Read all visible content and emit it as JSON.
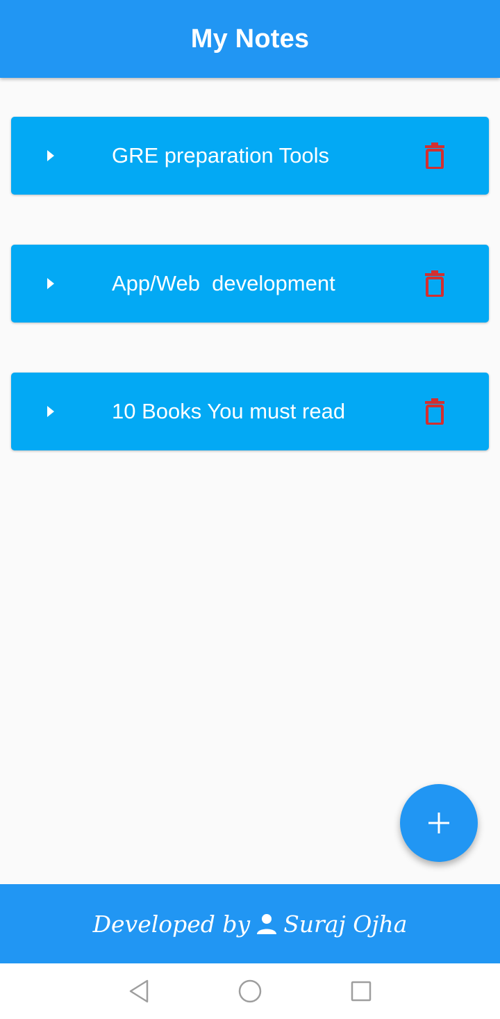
{
  "app": {
    "title": "My Notes"
  },
  "notes": [
    {
      "title": "GRE preparation Tools"
    },
    {
      "title": "App/Web  development"
    },
    {
      "title": "10 Books You must read"
    }
  ],
  "footer": {
    "prefix": "Developed by",
    "author": "Suraj Ojha",
    "icon": "person-icon"
  },
  "icons": {
    "expand": "arrow-right-icon",
    "delete": "trash-icon",
    "fab": "plus-icon",
    "nav": [
      "back-icon",
      "home-icon",
      "recents-icon"
    ]
  },
  "colors": {
    "primary": "#2196F3",
    "card": "#03A9F4",
    "delete": "#D32F2F",
    "background": "#FAFAFA",
    "text_on_primary": "#FFFFFF"
  }
}
